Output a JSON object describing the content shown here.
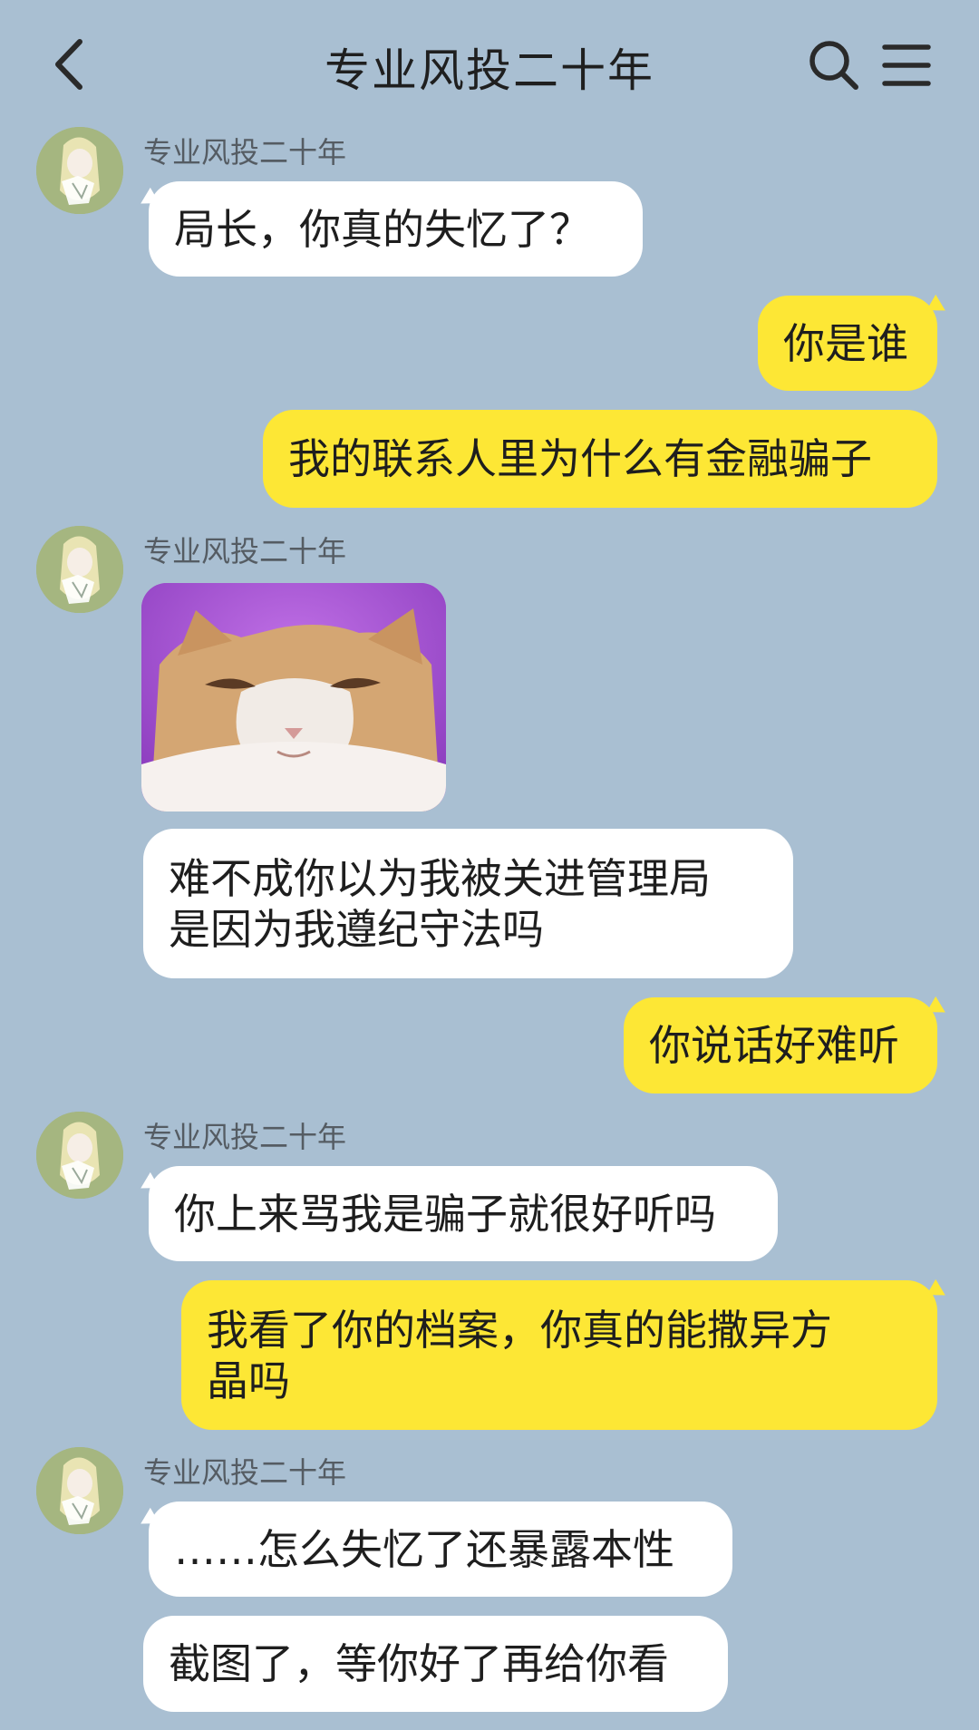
{
  "header": {
    "title": "专业风投二十年",
    "back_icon": "chevron-left-icon",
    "search_icon": "search-icon",
    "menu_icon": "menu-icon"
  },
  "messages": [
    {
      "side": "left",
      "sender": "专业风投二十年",
      "text": "局长，你真的失忆了？"
    },
    {
      "side": "right",
      "text": "你是谁"
    },
    {
      "side": "right",
      "text": "我的联系人里为什么有金融骗子"
    },
    {
      "side": "left",
      "sender": "专业风投二十年",
      "type": "sticker",
      "sticker": "smug-cat-sticker"
    },
    {
      "side": "left",
      "text_line1": "难不成你以为我被关进管理局",
      "text_line2": "是因为我遵纪守法吗"
    },
    {
      "side": "right",
      "text": "你说话好难听"
    },
    {
      "side": "left",
      "sender": "专业风投二十年",
      "text": "你上来骂我是骗子就很好听吗"
    },
    {
      "side": "right",
      "text_line1": "我看了你的档案，你真的能撒异方",
      "text_line2": "晶吗"
    },
    {
      "side": "left",
      "sender": "专业风投二十年",
      "text": "……怎么失忆了还暴露本性"
    },
    {
      "side": "left",
      "text": "截图了，等你好了再给你看"
    }
  ],
  "colors": {
    "background": "#a9bfd2",
    "incoming_bubble": "#ffffff",
    "outgoing_bubble": "#fde735"
  }
}
